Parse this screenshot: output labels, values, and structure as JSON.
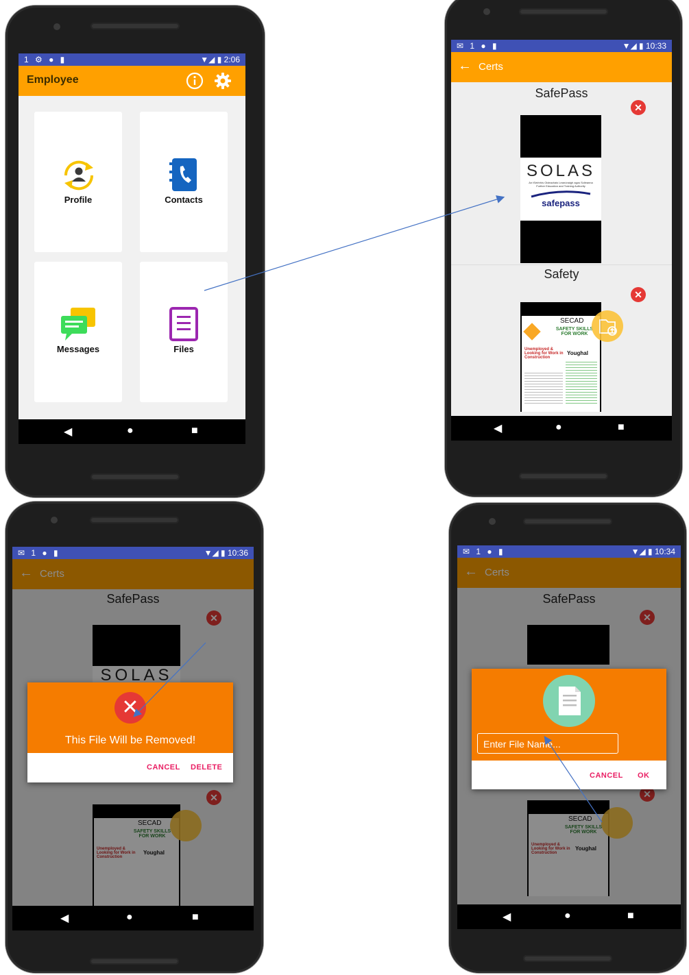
{
  "screen1": {
    "status_left": "1 ⚙ ● ▮",
    "status_right": "▼◢ ▮ 2:06",
    "title": "Employee",
    "tiles": [
      {
        "label": "Profile",
        "icon": "profile-sync-icon"
      },
      {
        "label": "Contacts",
        "icon": "contacts-book-icon"
      },
      {
        "label": "Messages",
        "icon": "chat-bubbles-icon"
      },
      {
        "label": "Files",
        "icon": "document-icon"
      }
    ]
  },
  "screen2": {
    "status_left": "✉ 1 ● ▮",
    "status_right": "▼◢ ▮ 10:33",
    "title": "Certs",
    "cert1_title": "SafePass",
    "cert2_title": "Safety",
    "solas_logo": "SOLAS",
    "solas_sub": "An tSeirbhís Oideachais Leanúnaigh agus Scileanna Further Education and Training Authority",
    "safepass_logo": "safepass",
    "poster_heading": "SECAD",
    "poster_sub": "SAFETY SKILLS FOR WORK",
    "poster_place": "Youghal",
    "poster_red": "Unemployed & Looking for Work in Construction"
  },
  "screen3": {
    "status_left": "✉ 1 ● ▮",
    "status_right": "▼◢ ▮ 10:36",
    "title": "Certs",
    "cert1_title": "SafePass",
    "dialog_message": "This File Will be Removed!",
    "cancel_label": "CANCEL",
    "delete_label": "DELETE"
  },
  "screen4": {
    "status_left": "✉ 1 ● ▮",
    "status_right": "▼◢ ▮ 10:34",
    "title": "Certs",
    "cert1_title": "SafePass",
    "input_placeholder": "Enter File Name...",
    "cancel_label": "CANCEL",
    "ok_label": "OK"
  },
  "nav": {
    "back": "◀",
    "home": "●",
    "recent": "■"
  },
  "colors": {
    "primary": "#3f51b5",
    "accent": "#ffa000",
    "dialog": "#f57c00",
    "danger": "#e53935",
    "pink": "#e91e63"
  }
}
